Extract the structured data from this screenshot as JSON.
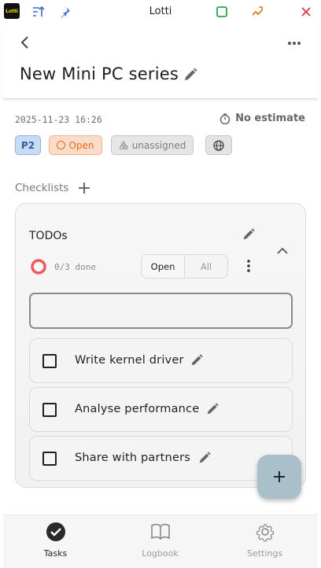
{
  "window": {
    "title": "Lotti",
    "logo_text": "Lotti"
  },
  "header": {
    "task_title": "New Mini PC series"
  },
  "meta": {
    "date": "2025-11-23 16:26",
    "estimate": "No estimate"
  },
  "chips": {
    "priority": "P2",
    "status": "Open",
    "category": "unassigned"
  },
  "checklists": {
    "section_label": "Checklists",
    "card": {
      "title": "TODOs",
      "progress": "0/3 done",
      "progress_fraction": 0,
      "filter_open": "Open",
      "filter_all": "All",
      "new_item_value": "",
      "items": [
        {
          "label": "Write kernel driver",
          "checked": false
        },
        {
          "label": "Analyse performance",
          "checked": false
        },
        {
          "label": "Share with partners",
          "checked": false
        }
      ]
    }
  },
  "bottom_nav": {
    "items": [
      {
        "label": "Tasks",
        "icon": "check-circle-icon",
        "active": true
      },
      {
        "label": "Logbook",
        "icon": "book-icon",
        "active": false
      },
      {
        "label": "Settings",
        "icon": "gear-icon",
        "active": false
      }
    ]
  },
  "colors": {
    "priority_bg": "#c8dcf6",
    "status_accent": "#e36b24",
    "progress_ring": "#f05a5a",
    "fab": "#a9bfca",
    "window_close": "#d63b3b",
    "window_maximize": "#2aa84a",
    "window_tile": "#e0781c"
  }
}
